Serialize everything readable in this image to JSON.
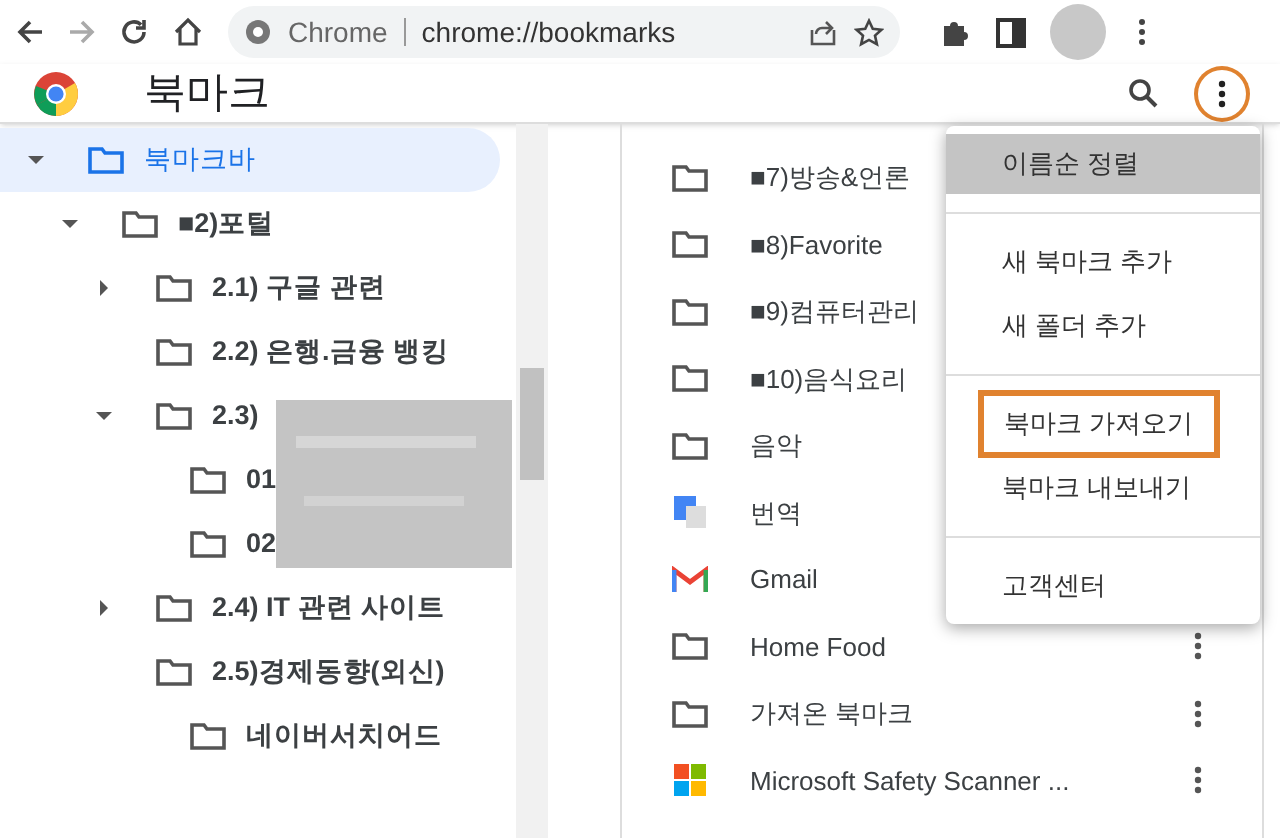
{
  "toolbar": {
    "site_label": "Chrome",
    "url": "chrome://bookmarks"
  },
  "header": {
    "title": "북마크",
    "menu_button_circled": true
  },
  "tree": [
    {
      "label": "북마크바",
      "selected": true,
      "expandable": true,
      "expanded": true,
      "children": [
        {
          "label": "■2)포털",
          "selected": false,
          "expandable": true,
          "expanded": true,
          "children": [
            {
              "label": "2.1) 구글 관련",
              "selected": false,
              "expandable": true,
              "expanded": false
            },
            {
              "label": "2.2) 은행.금융 뱅킹",
              "selected": false,
              "expandable": false,
              "expanded": false
            },
            {
              "label": "2.3)",
              "selected": false,
              "expandable": true,
              "expanded": true,
              "children": [
                {
                  "label": "01",
                  "selected": false,
                  "expandable": false,
                  "expanded": false
                },
                {
                  "label": "02",
                  "selected": false,
                  "expandable": false,
                  "expanded": false
                }
              ]
            },
            {
              "label": "2.4) IT 관련 사이트",
              "selected": false,
              "expandable": true,
              "expanded": false
            },
            {
              "label": "2.5)경제동향(외신)",
              "selected": false,
              "expandable": false,
              "expanded": true,
              "children": [
                {
                  "label": "네이버서치어드",
                  "selected": false,
                  "expandable": false,
                  "expanded": false
                }
              ]
            }
          ]
        }
      ]
    }
  ],
  "list": [
    {
      "kind": "folder",
      "label": "■7)방송&언론"
    },
    {
      "kind": "folder",
      "label": "■8)Favorite"
    },
    {
      "kind": "folder",
      "label": "■9)컴퓨터관리"
    },
    {
      "kind": "folder",
      "label": "■10)음식요리"
    },
    {
      "kind": "folder",
      "label": "음악"
    },
    {
      "kind": "translate",
      "label": "번역"
    },
    {
      "kind": "gmail",
      "label": "Gmail"
    },
    {
      "kind": "folder",
      "label": "Home Food"
    },
    {
      "kind": "folder",
      "label": "가져온 북마크"
    },
    {
      "kind": "microsoft",
      "label": "Microsoft Safety Scanner ..."
    }
  ],
  "menu": [
    {
      "label": "이름순 정렬",
      "selected": true,
      "highlighted": false,
      "divider_after": true
    },
    {
      "label": "새 북마크 추가",
      "selected": false,
      "highlighted": false,
      "divider_after": false
    },
    {
      "label": "새 폴더 추가",
      "selected": false,
      "highlighted": false,
      "divider_after": true
    },
    {
      "label": "북마크 가져오기",
      "selected": false,
      "highlighted": true,
      "divider_after": false
    },
    {
      "label": "북마크 내보내기",
      "selected": false,
      "highlighted": false,
      "divider_after": true
    },
    {
      "label": "고객센터",
      "selected": false,
      "highlighted": false,
      "divider_after": false
    }
  ]
}
